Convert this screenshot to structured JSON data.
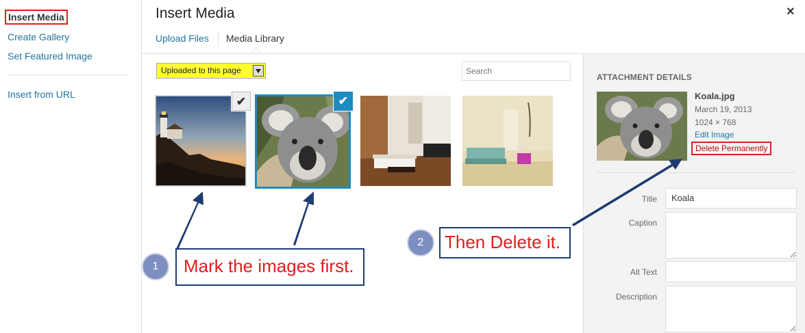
{
  "sidebar": {
    "items": [
      {
        "label": "Insert Media"
      },
      {
        "label": "Create Gallery"
      },
      {
        "label": "Set Featured Image"
      },
      {
        "label": "Insert from URL"
      }
    ]
  },
  "header": {
    "title": "Insert Media",
    "close_symbol": "×",
    "tabs": [
      {
        "label": "Upload Files"
      },
      {
        "label": "Media Library"
      }
    ]
  },
  "toolbar": {
    "filter_value": "Uploaded to this page",
    "search_placeholder": "Search"
  },
  "grid": {
    "items": [
      {
        "subject": "lighthouse-at-dusk",
        "selected": false,
        "check": "✔"
      },
      {
        "subject": "koala",
        "selected": true,
        "check": "✔"
      },
      {
        "subject": "living-room-brown",
        "selected": false
      },
      {
        "subject": "living-room-cream",
        "selected": false
      }
    ]
  },
  "details": {
    "heading": "ATTACHMENT DETAILS",
    "filename": "Koala.jpg",
    "date": "March 19, 2013",
    "dimensions": "1024 × 768",
    "edit_label": "Edit Image",
    "delete_label": "Delete Permanently",
    "fields": [
      {
        "label": "Title",
        "value": "Koala"
      },
      {
        "label": "Caption",
        "value": ""
      },
      {
        "label": "Alt Text",
        "value": ""
      },
      {
        "label": "Description",
        "value": ""
      }
    ]
  },
  "callouts": [
    {
      "number": "1",
      "text": "Mark the images first."
    },
    {
      "number": "2",
      "text": "Then Delete it."
    }
  ],
  "colors": {
    "link": "#21759b",
    "selected_border": "#1e8cbe",
    "highlight_red": "#e01e1e",
    "filter_yellow": "#ffff33",
    "callout_navy": "#1f3c72"
  }
}
